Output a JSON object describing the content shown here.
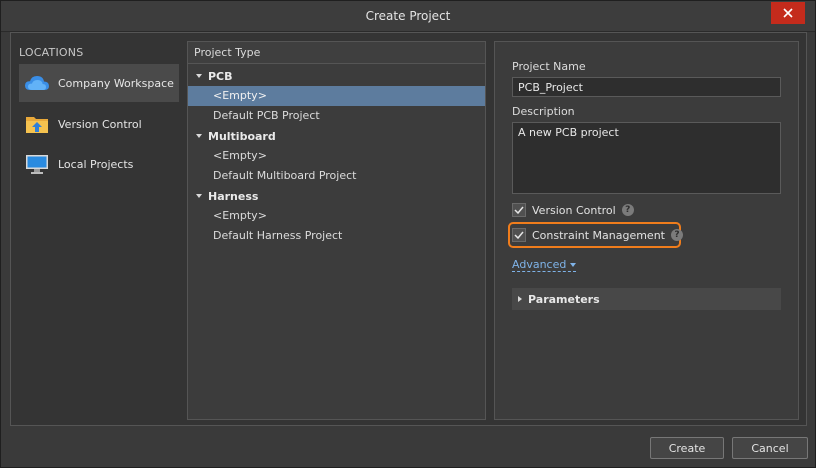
{
  "window": {
    "title": "Create Project"
  },
  "colors": {
    "accent_selection": "#5d7c9e",
    "highlight_outline": "#f07d1c",
    "close_button": "#c42b1c",
    "link": "#7fb3e8"
  },
  "locations": {
    "header": "LOCATIONS",
    "items": [
      {
        "label": "Company Workspace",
        "icon": "cloud-icon",
        "selected": true
      },
      {
        "label": "Version Control",
        "icon": "folder-upload-icon",
        "selected": false
      },
      {
        "label": "Local Projects",
        "icon": "monitor-icon",
        "selected": false
      }
    ]
  },
  "project_type": {
    "header": "Project Type",
    "groups": [
      {
        "name": "PCB",
        "items": [
          "<Empty>",
          "Default PCB Project"
        ]
      },
      {
        "name": "Multiboard",
        "items": [
          "<Empty>",
          "Default Multiboard Project"
        ]
      },
      {
        "name": "Harness",
        "items": [
          "<Empty>",
          "Default Harness Project"
        ]
      }
    ],
    "selected": "PCB / <Empty>"
  },
  "form": {
    "project_name_label": "Project Name",
    "project_name_value": "PCB_Project",
    "description_label": "Description",
    "description_value": "A new PCB project",
    "version_control_label": "Version Control",
    "version_control_checked": true,
    "constraint_label": "Constraint Management",
    "constraint_checked": true,
    "help_glyph": "?",
    "advanced_label": "Advanced",
    "parameters_label": "Parameters"
  },
  "footer": {
    "create_label": "Create",
    "cancel_label": "Cancel"
  }
}
